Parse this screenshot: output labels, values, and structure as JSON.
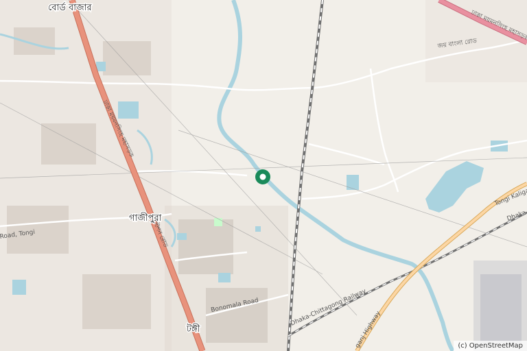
{
  "map": {
    "attribution": "(c) OpenStreetMap",
    "marker": {
      "name": "location-pin",
      "color": "#1a8a5a"
    },
    "colors": {
      "land": "#f2efe9",
      "water": "#aad3df",
      "trunk": "#e8927c",
      "primary": "#fcd6a4",
      "secondary": "#f7fabf",
      "motorway": "#e990a0",
      "railway": "#707070",
      "road": "#ffffff",
      "urban": "#d9d0c9",
      "park": "#c8facc"
    },
    "places": {
      "board_bazar": "বোর্ড বাজার",
      "gazipura": "গাজীপুরা",
      "tongi": "টঙ্গী"
    },
    "roads": {
      "dhaka_mymensingh_hwy": "ঢাকা ময়মনসিংহ মহাসড়ক",
      "dhaka_mymensingh_hwy_ne": "ঢাকা ময়মনসিংহ মহাসড়ক",
      "joy_bangla_road": "জয় বাংলা রোড",
      "bonomala_road": "Bonomala Road",
      "dhaka_chittagong_railway": "Dhaka-Chittagong Railway",
      "tongi_kaliganj_road": "Tongi Kaliga",
      "tongi_road": "Road, Tongi",
      "dhaka_label": "Dhaka",
      "ganj_highway": "ganj Highway",
      "station_road": "স্টেশন রোড"
    }
  }
}
